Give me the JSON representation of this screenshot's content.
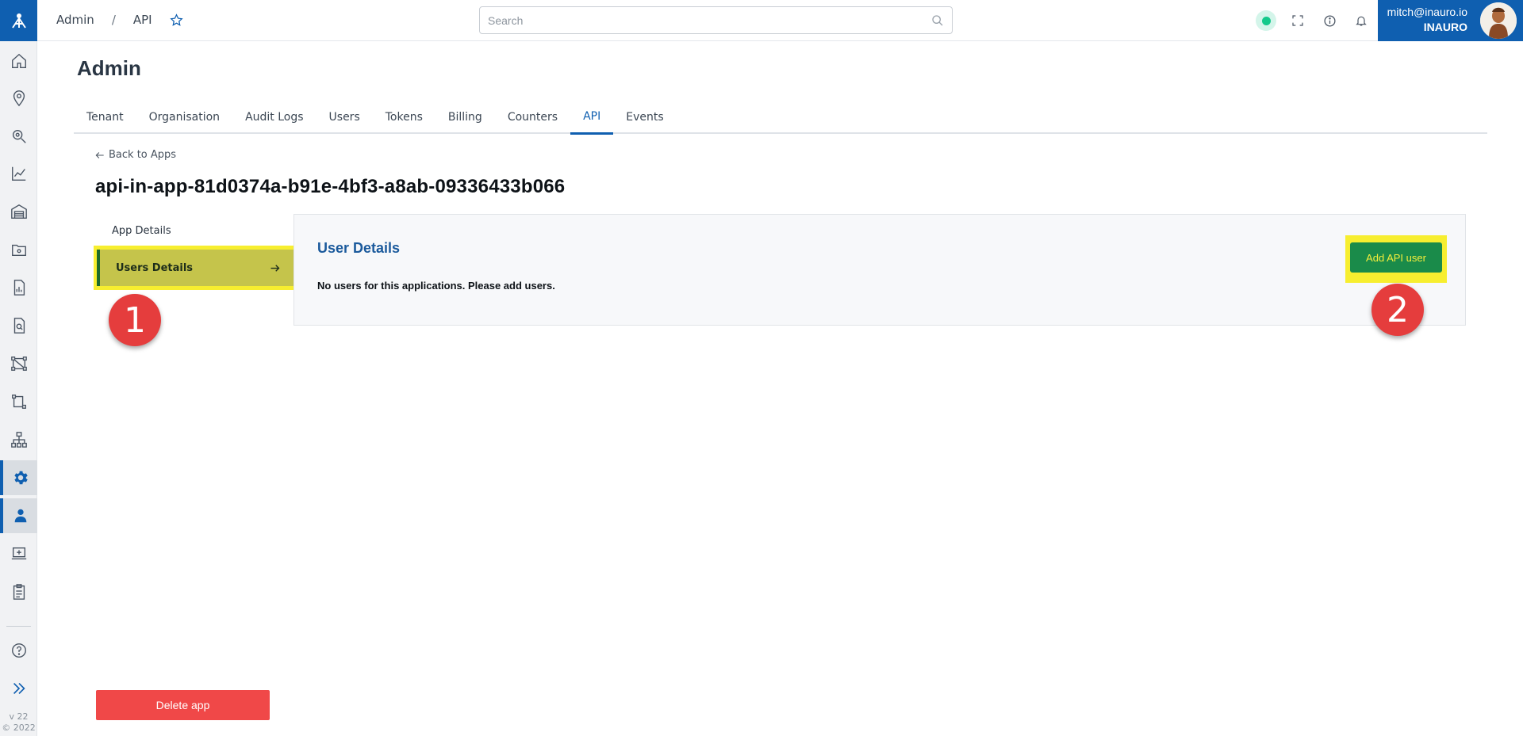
{
  "breadcrumb": {
    "root": "Admin",
    "separator": "/",
    "current": "API"
  },
  "search": {
    "placeholder": "Search"
  },
  "user": {
    "email": "mitch@inauro.io",
    "org": "INAURO"
  },
  "version": {
    "number": "v 22",
    "copyright": "© 2022"
  },
  "page": {
    "title": "Admin"
  },
  "tabs": [
    "Tenant",
    "Organisation",
    "Audit Logs",
    "Users",
    "Tokens",
    "Billing",
    "Counters",
    "API",
    "Events"
  ],
  "active_tab": "API",
  "content": {
    "back_link": "Back to Apps",
    "app_name": "api-in-app-81d0374a-b91e-4bf3-a8ab-09336433b066",
    "subnav": {
      "app_details": "App Details",
      "users_details": "Users Details"
    },
    "details": {
      "title": "User Details",
      "empty_message": "No users for this applications. Please add users.",
      "add_button": "Add API user"
    },
    "delete_button": "Delete app"
  },
  "annotations": {
    "step_1": "1",
    "step_2": "2"
  },
  "sidebar_icons": [
    "home-icon",
    "location-pin-icon",
    "search-location-icon",
    "chart-line-icon",
    "warehouse-icon",
    "folder-settings-icon",
    "report-icon",
    "document-search-icon",
    "network-icon",
    "workflow-icon",
    "hierarchy-icon",
    "settings-icon",
    "user-admin-icon",
    "laptop-add-icon",
    "clipboard-icon",
    "help-icon",
    "expand-icon"
  ],
  "colors": {
    "brand": "#0f5fb0",
    "highlight": "#f7ee2f",
    "success": "#1a8b4a",
    "danger": "#f04848",
    "badge": "#e53d3d"
  }
}
